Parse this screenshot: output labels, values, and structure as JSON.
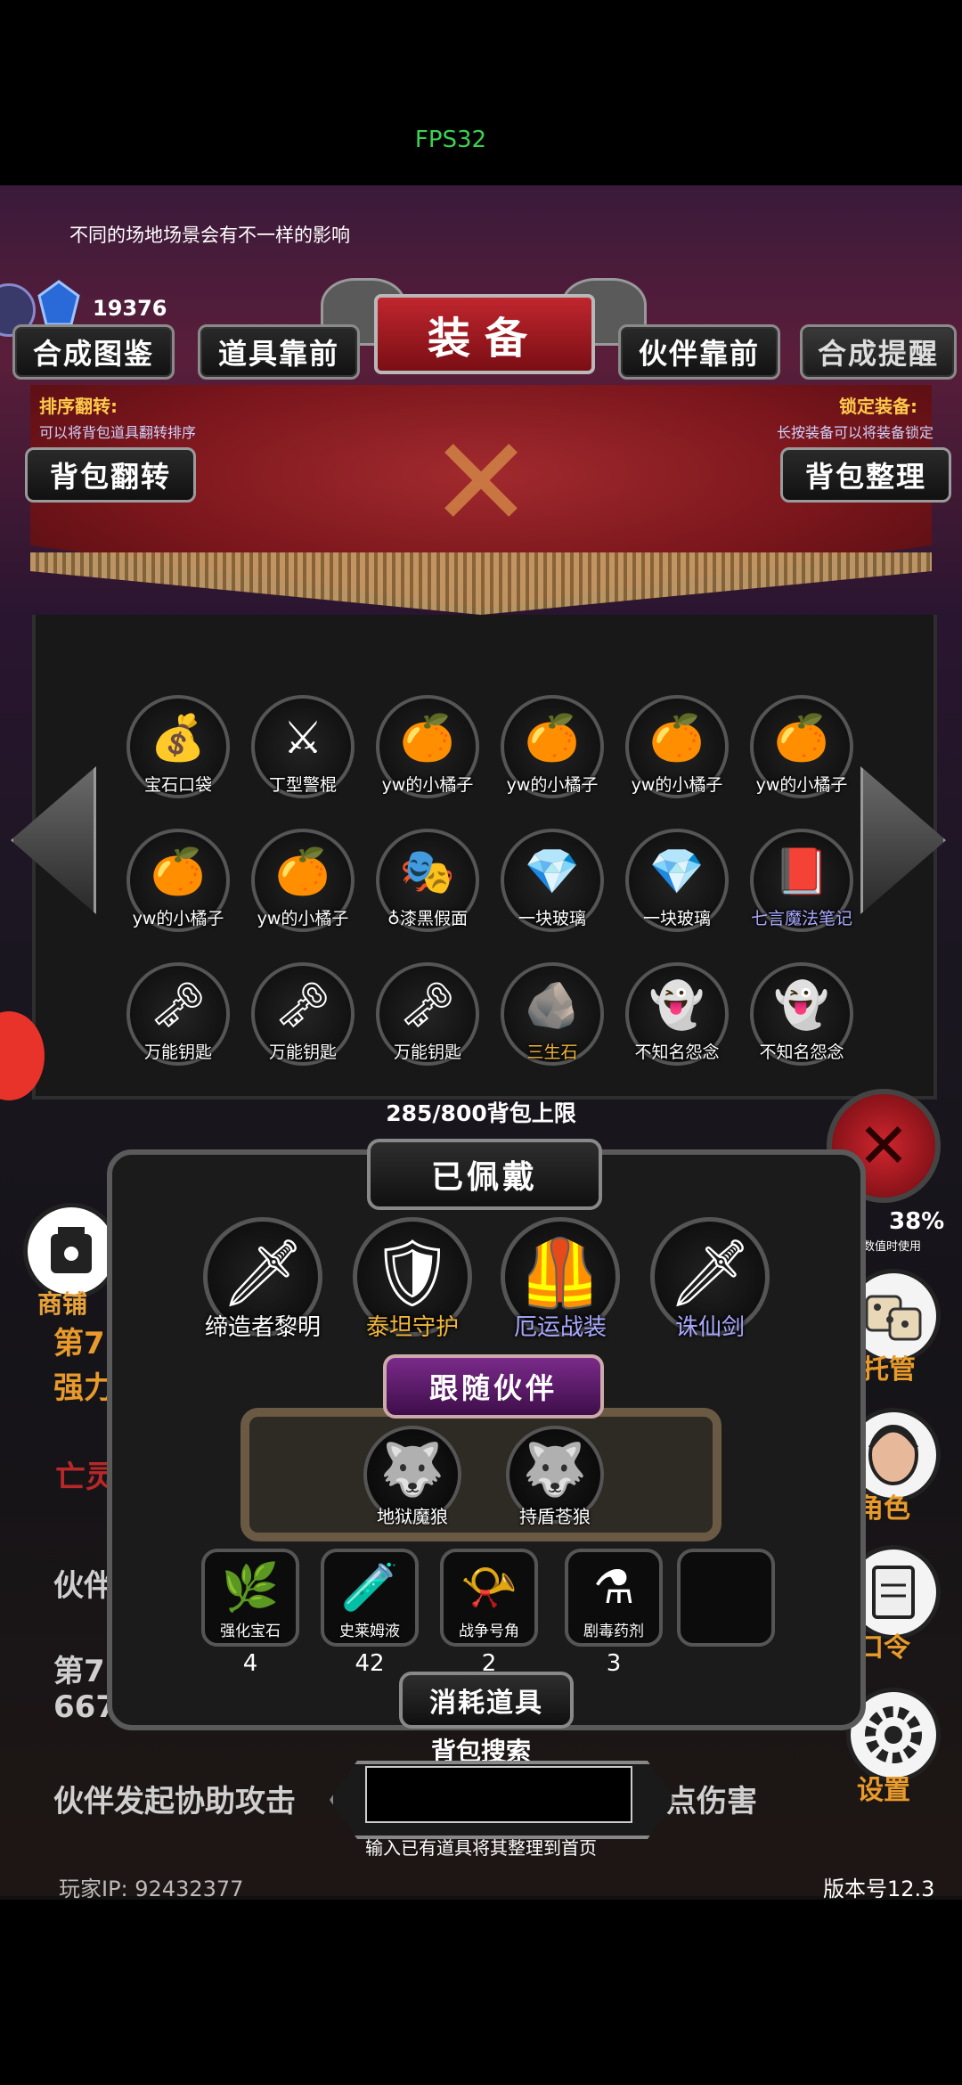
{
  "fps": "FPS32",
  "hint": "不同的场地场景会有不一样的影响",
  "gem_count": "19376",
  "header": {
    "title": "装备",
    "btn_recipe": "合成图鉴",
    "btn_items_front": "道具靠前",
    "btn_partner_front": "伙伴靠前",
    "btn_synth_remind": "合成提醒"
  },
  "sort": {
    "title": "排序翻转:",
    "desc": "可以将背包道具翻转排序",
    "btn": "背包翻转"
  },
  "lock": {
    "title": "锁定装备:",
    "desc": "长按装备可以将装备锁定",
    "btn": "背包整理"
  },
  "inventory": [
    {
      "icon": "💰",
      "label": "宝石口袋"
    },
    {
      "icon": "⚔",
      "label": "丁型警棍"
    },
    {
      "icon": "🍊",
      "label": "yw的小橘子"
    },
    {
      "icon": "🍊",
      "label": "yw的小橘子"
    },
    {
      "icon": "🍊",
      "label": "yw的小橘子"
    },
    {
      "icon": "🍊",
      "label": "yw的小橘子"
    },
    {
      "icon": "🍊",
      "label": "yw的小橘子"
    },
    {
      "icon": "🍊",
      "label": "yw的小橘子"
    },
    {
      "icon": "🎭",
      "label": "♁漆黑假面"
    },
    {
      "icon": "💎",
      "label": "一块玻璃"
    },
    {
      "icon": "💎",
      "label": "一块玻璃"
    },
    {
      "icon": "📕",
      "label": "七言魔法笔记"
    },
    {
      "icon": "🗝",
      "label": "万能钥匙"
    },
    {
      "icon": "🗝",
      "label": "万能钥匙"
    },
    {
      "icon": "🗝",
      "label": "万能钥匙"
    },
    {
      "icon": "🪨",
      "label": "三生石"
    },
    {
      "icon": "👻",
      "label": "不知名怨念"
    },
    {
      "icon": "👻",
      "label": "不知名怨念"
    }
  ],
  "capacity": "285/800背包上限",
  "equipped_title": "已佩戴",
  "equipped": [
    {
      "icon": "🗡",
      "label": "缔造者黎明"
    },
    {
      "icon": "🛡",
      "label": "泰坦守护"
    },
    {
      "icon": "🦺",
      "label": "厄运战装"
    },
    {
      "icon": "🗡",
      "label": "诛仙剑"
    }
  ],
  "follow_title": "跟随伙伴",
  "partners": [
    {
      "icon": "🐺",
      "label": "地狱魔狼"
    },
    {
      "icon": "🐺",
      "label": "持盾苍狼"
    }
  ],
  "consumables_title": "消耗道具",
  "consumables": [
    {
      "icon": "🌿",
      "label": "强化宝石",
      "count": "4"
    },
    {
      "icon": "🧪",
      "label": "史莱姆液",
      "count": "42"
    },
    {
      "icon": "📯",
      "label": "战争号角",
      "count": "2"
    },
    {
      "icon": "⚗",
      "label": "剧毒药剂",
      "count": "3"
    }
  ],
  "search": {
    "label": "背包搜索",
    "placeholder": "",
    "tip": "输入已有道具将其整理到首页"
  },
  "background": {
    "shop": "商铺",
    "line1": "第7",
    "line2": "强力",
    "line3": "亡灵",
    "line4": "伙伴",
    "line5": "第7",
    "line6": "667",
    "line7": "伙伴发起协助攻击",
    "line7b": "点伤害",
    "right_top": "其数值时使用",
    "right_pct": "38%",
    "right1": "托管",
    "right2": "角色",
    "right3": "口令",
    "right4": "设置"
  },
  "player_ip": "玩家IP: 92432377",
  "version": "版本号12.3",
  "colors": {
    "accent_red": "#c0262e",
    "gold_text": "#f0b43a",
    "purple": "#7a2a8a"
  }
}
